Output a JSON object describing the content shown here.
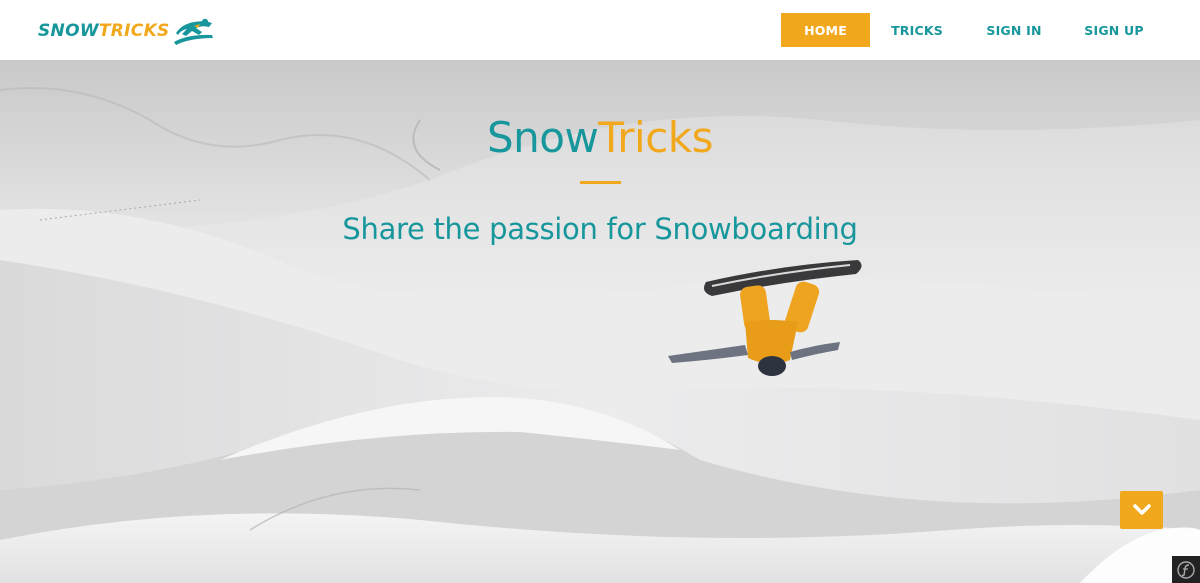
{
  "navbar": {
    "logo": {
      "snow": "SNOW",
      "tricks": "TRICKS",
      "icon": "snowboarder-logo-icon"
    },
    "items": [
      {
        "label": "HOME",
        "active": true
      },
      {
        "label": "TRICKS",
        "active": false
      },
      {
        "label": "SIGN IN",
        "active": false
      },
      {
        "label": "SIGN UP",
        "active": false
      }
    ]
  },
  "hero": {
    "title_snow": "Snow",
    "title_tricks": "Tricks",
    "subtitle": "Share the passion for Snowboarding",
    "scroll_icon": "chevron-down-icon"
  },
  "debug_toolbar": {
    "icon": "symfony-icon"
  },
  "colors": {
    "teal": "#17979c",
    "orange": "#f2a81d",
    "white": "#ffffff"
  }
}
